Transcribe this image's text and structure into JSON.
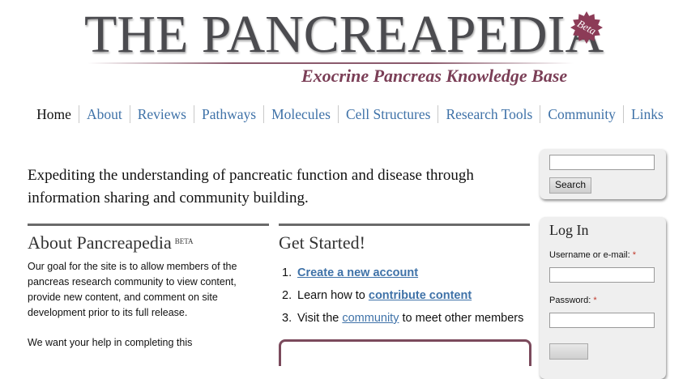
{
  "header": {
    "title_the": "THE",
    "title_main": "PANCREAPEDIA",
    "badge": "Beta",
    "subtitle": "Exocrine Pancreas Knowledge Base"
  },
  "nav": {
    "items": [
      {
        "label": "Home",
        "active": true
      },
      {
        "label": "About"
      },
      {
        "label": "Reviews"
      },
      {
        "label": "Pathways"
      },
      {
        "label": "Molecules"
      },
      {
        "label": "Cell Structures"
      },
      {
        "label": "Research Tools"
      },
      {
        "label": "Community"
      },
      {
        "label": "Links"
      }
    ]
  },
  "intro": {
    "text": "Expediting the understanding of pancreatic function and disease through information sharing and community building."
  },
  "about": {
    "title": "About Pancreapedia",
    "title_sup": "BETA",
    "para1": "Our goal for the site is to allow members of the pancreas research community to view content, provide new content, and comment on site development prior to its full release.",
    "para2": "We want your help in completing this"
  },
  "get_started": {
    "title": "Get Started!",
    "step1_num": "1.",
    "step1_link": "Create a new account",
    "step2_num": "2.",
    "step2_prefix": "Learn how to ",
    "step2_link": "contribute content",
    "step3_num": "3.",
    "step3_prefix": "Visit the ",
    "step3_link": "community",
    "step3_suffix": " to meet other members"
  },
  "search": {
    "value": "",
    "button": "Search"
  },
  "login": {
    "title": "Log In",
    "username_label": "Username or e-mail:",
    "password_label": "Password:",
    "required_mark": "*"
  },
  "colors": {
    "link": "#3f72a8",
    "brand_maroon": "#7b3f57",
    "logo_gray": "#4b4b4f"
  }
}
